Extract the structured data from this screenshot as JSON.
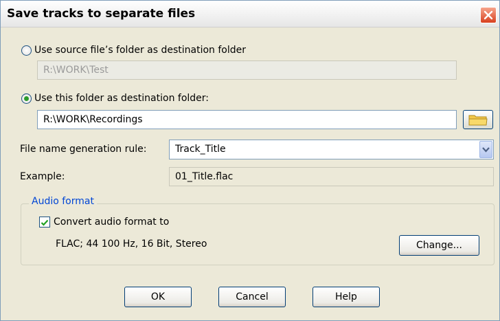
{
  "window": {
    "title": "Save tracks to separate files"
  },
  "source_option": {
    "label": "Use source file’s folder as destination folder",
    "path": "R:\\WORK\\Test"
  },
  "folder_option": {
    "label": "Use this folder as destination folder:",
    "path": "R:\\WORK\\Recordings"
  },
  "rule": {
    "label": "File name generation rule:",
    "value": "Track_Title"
  },
  "example": {
    "label": "Example:",
    "value": "01_Title.flac"
  },
  "audio_format": {
    "legend": "Audio format",
    "convert_label": "Convert audio format to",
    "convert_checked": true,
    "format": "FLAC; 44 100 Hz, 16 Bit, Stereo",
    "change_label": "Change..."
  },
  "buttons": {
    "ok": "OK",
    "cancel": "Cancel",
    "help": "Help"
  },
  "colors": {
    "accent": "#0046d5",
    "radio_selected": "#2b9b2b",
    "close_button": "#d8401f"
  }
}
